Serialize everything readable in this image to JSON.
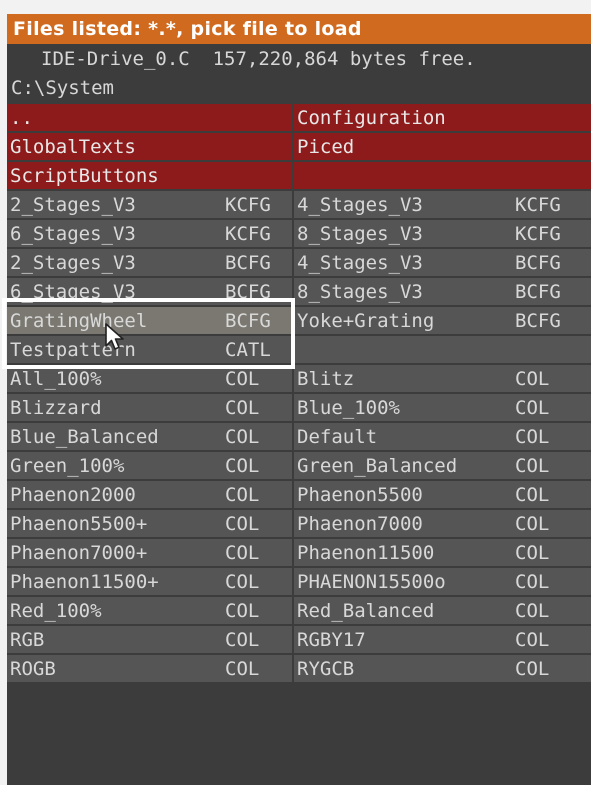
{
  "title": "Files listed: *.*, pick file to load",
  "drive_line": "IDE-Drive_0.C  157,220,864 bytes free.",
  "path": "C:\\System",
  "rows": [
    {
      "left": {
        "name": "..",
        "ext": "",
        "type": "dir"
      },
      "right": {
        "name": "Configuration",
        "ext": "",
        "type": "dir"
      }
    },
    {
      "left": {
        "name": "GlobalTexts",
        "ext": "",
        "type": "dir"
      },
      "right": {
        "name": "Piced",
        "ext": "",
        "type": "dir"
      }
    },
    {
      "left": {
        "name": "ScriptButtons",
        "ext": "",
        "type": "dir"
      },
      "right": {
        "name": "",
        "ext": "",
        "type": "dir"
      }
    },
    {
      "left": {
        "name": "2_Stages_V3",
        "ext": "KCFG"
      },
      "right": {
        "name": "4_Stages_V3",
        "ext": "KCFG"
      }
    },
    {
      "left": {
        "name": "6_Stages_V3",
        "ext": "KCFG"
      },
      "right": {
        "name": "8_Stages_V3",
        "ext": "KCFG"
      }
    },
    {
      "left": {
        "name": "2_Stages_V3",
        "ext": "BCFG"
      },
      "right": {
        "name": "4_Stages_V3",
        "ext": "BCFG"
      }
    },
    {
      "left": {
        "name": "6_Stages_V3",
        "ext": "BCFG"
      },
      "right": {
        "name": "8_Stages_V3",
        "ext": "BCFG"
      }
    },
    {
      "left": {
        "name": "GratingWheel",
        "ext": "BCFG",
        "type": "selected"
      },
      "right": {
        "name": "Yoke+Grating",
        "ext": "BCFG"
      }
    },
    {
      "left": {
        "name": "Testpattern",
        "ext": "CATL"
      },
      "right": {
        "name": "",
        "ext": ""
      }
    },
    {
      "left": {
        "name": "All_100%",
        "ext": "COL"
      },
      "right": {
        "name": "Blitz",
        "ext": "COL"
      }
    },
    {
      "left": {
        "name": "Blizzard",
        "ext": "COL"
      },
      "right": {
        "name": "Blue_100%",
        "ext": "COL"
      }
    },
    {
      "left": {
        "name": "Blue_Balanced",
        "ext": "COL"
      },
      "right": {
        "name": "Default",
        "ext": "COL"
      }
    },
    {
      "left": {
        "name": "Green_100%",
        "ext": "COL"
      },
      "right": {
        "name": "Green_Balanced",
        "ext": "COL"
      }
    },
    {
      "left": {
        "name": "Phaenon2000",
        "ext": "COL"
      },
      "right": {
        "name": "Phaenon5500",
        "ext": "COL"
      }
    },
    {
      "left": {
        "name": "Phaenon5500+",
        "ext": "COL"
      },
      "right": {
        "name": "Phaenon7000",
        "ext": "COL"
      }
    },
    {
      "left": {
        "name": "Phaenon7000+",
        "ext": "COL"
      },
      "right": {
        "name": "Phaenon11500",
        "ext": "COL"
      }
    },
    {
      "left": {
        "name": "Phaenon11500+",
        "ext": "COL"
      },
      "right": {
        "name": "PHAENON15500o",
        "ext": "COL"
      }
    },
    {
      "left": {
        "name": "Red_100%",
        "ext": "COL"
      },
      "right": {
        "name": "Red_Balanced",
        "ext": "COL"
      }
    },
    {
      "left": {
        "name": "RGB",
        "ext": "COL"
      },
      "right": {
        "name": "RGBY17",
        "ext": "COL"
      }
    },
    {
      "left": {
        "name": "ROGB",
        "ext": "COL"
      },
      "right": {
        "name": "RYGCB",
        "ext": "COL"
      }
    }
  ],
  "colors": {
    "title_bg": "#d06a1e",
    "dir_bg": "#8e1b1b",
    "file_bg": "#555555",
    "selected_bg": "#7a7870",
    "panel_bg": "#3c3c3c"
  },
  "icons": {
    "cursor": "mouse-pointer-icon"
  }
}
